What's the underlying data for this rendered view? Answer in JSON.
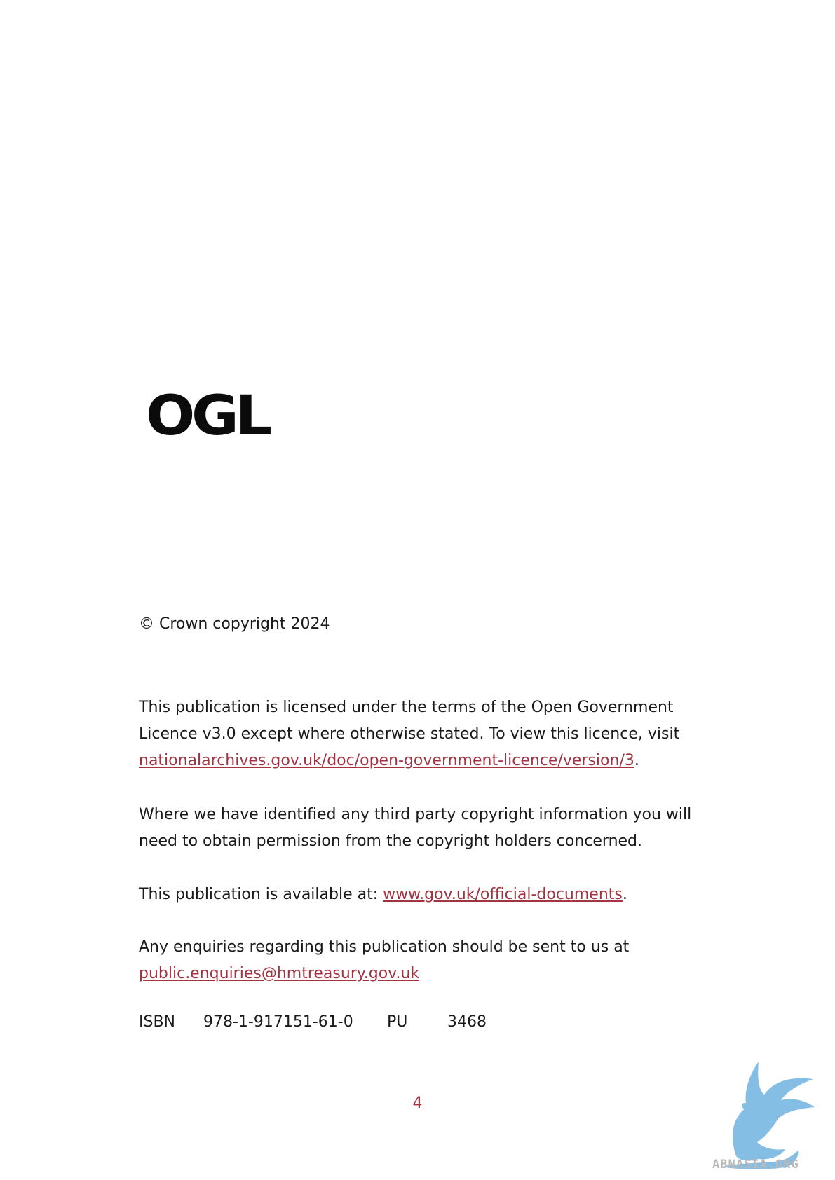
{
  "logo": {
    "text": "OGL"
  },
  "copyright": "© Crown copyright 2024",
  "licence_para": {
    "line1": "This publication is licensed under the terms of the Open Government",
    "line2": "Licence v3.0 except where otherwise stated. To view this licence, visit",
    "link": "nationalarchives.gov.uk/doc/open-government-licence/version/3",
    "after": "."
  },
  "third_party": {
    "line1": "Where we have identified any third party copyright information you will",
    "line2": "need to obtain permission from the copyright holders concerned."
  },
  "available": {
    "prefix": "This publication is available at: ",
    "link": "www.gov.uk/official-documents",
    "after": "."
  },
  "enquiries": {
    "line1": "Any enquiries regarding this publication should be sent to us at",
    "link": "public.enquiries@hmtreasury.gov.uk"
  },
  "isbn": {
    "label": "ISBN",
    "value": "978-1-917151-61-0",
    "pu_label": "PU",
    "pu_value": "3468"
  },
  "page_number": "4",
  "watermark": {
    "text": "ABNASIA.ORG"
  },
  "colors": {
    "link": "#a33340",
    "text": "#1a1a1a",
    "watermark": "#6fb3e0"
  }
}
